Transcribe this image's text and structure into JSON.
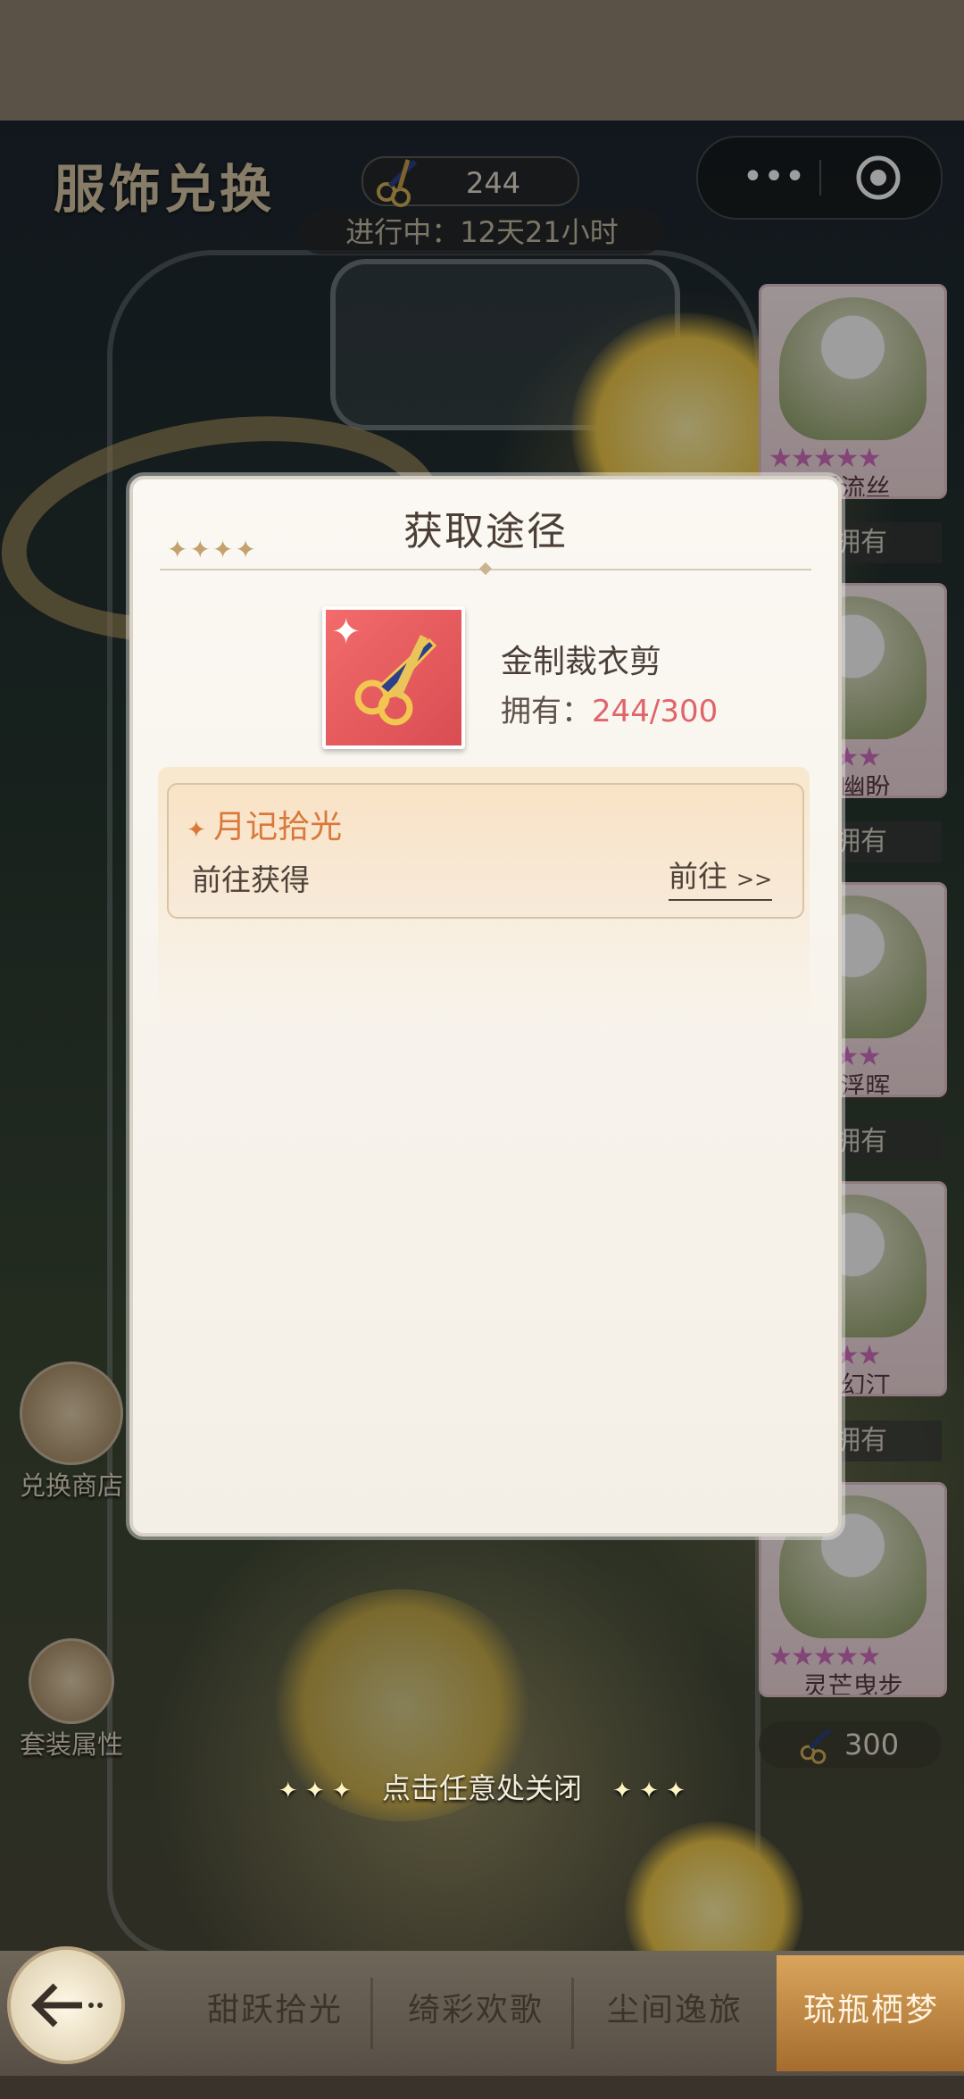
{
  "header": {
    "title": "服饰兑换",
    "currency_value": "244",
    "status": "进行中：12天21小时",
    "more_glyph": "•••"
  },
  "right_cards": [
    {
      "name": "露流丝",
      "owned": "拥有"
    },
    {
      "name": "花幽盼",
      "owned": "拥有"
    },
    {
      "name": "露浮晖",
      "owned": "拥有"
    },
    {
      "name": "露幻汀",
      "owned": "拥有"
    },
    {
      "name": "灵芒曳步",
      "price": "300"
    }
  ],
  "card_stars": "★★★★★",
  "side_buttons": {
    "shop": "兑换商店",
    "suit": "套装属性"
  },
  "modal": {
    "title": "获取途径",
    "decor_stars": "✦✦✦✦",
    "item_name": "金制裁衣剪",
    "owned_label": "拥有：",
    "owned_count": "244/300",
    "source": {
      "title": "月记拾光",
      "description": "前往获得",
      "go_label": "前往",
      "go_arrows": ">>"
    }
  },
  "close_hint": "点击任意处关闭",
  "bottom_tabs": [
    "甜跃拾光",
    "绮彩欢歌",
    "尘间逸旅",
    "琉瓶栖梦"
  ],
  "colors": {
    "accent_orange": "#d9783a",
    "count_red": "#e0646a",
    "star_pink": "#d36fc2"
  }
}
